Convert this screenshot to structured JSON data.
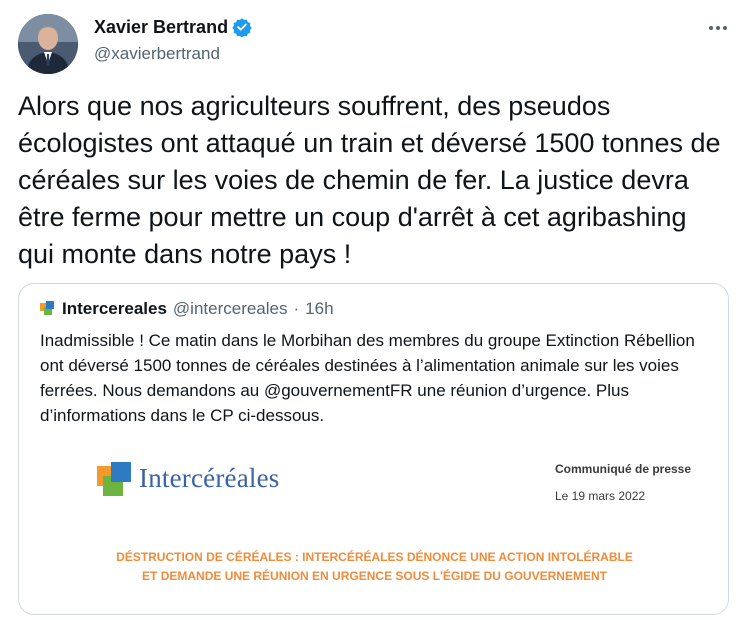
{
  "author": {
    "display_name": "Xavier Bertrand",
    "handle": "@xavierbertrand",
    "avatar_icon": "profile-photo",
    "verified_icon": "verified-badge-icon",
    "verified_color": "#1d9bf0"
  },
  "menu": {
    "more_icon": "more-options-icon"
  },
  "tweet": {
    "text": "Alors que nos agriculteurs souffrent, des pseudos écologistes ont attaqué un train et déversé 1500 tonnes de céréales sur les voies de chemin de fer. La justice devra être ferme pour mettre un coup d'arrêt à cet agribashing qui monte dans notre pays !"
  },
  "quote": {
    "author_name": "Intercereales",
    "handle": "@intercereales",
    "separator": "·",
    "time": "16h",
    "text": "Inadmissible ! Ce matin dans le Morbihan des membres du groupe Extinction Rébellion ont déversé 1500 tonnes de céréales destinées à l’alimentation animale sur les voies ferrées. Nous demandons au @gouvernementFR  une réunion d’urgence. Plus d’informations dans le CP ci-dessous.",
    "media": {
      "logo_text": "Intercéréales",
      "doc_type": "Communiqué de presse",
      "doc_date": "Le 19 mars 2022",
      "headline_line1": "DÉSTRUCTION DE CÉRÉALES : INTERCÉRÉALES DÉNONCE UNE ACTION INTOLÉRABLE",
      "headline_line2": "ET DEMANDE UNE RÉUNION EN URGENCE SOUS L'ÉGIDE DU GOUVERNEMENT",
      "headline_color": "#f08b3a",
      "logo_colors": [
        "#2e7bc4",
        "#f29a2e",
        "#6cb33f"
      ]
    }
  }
}
